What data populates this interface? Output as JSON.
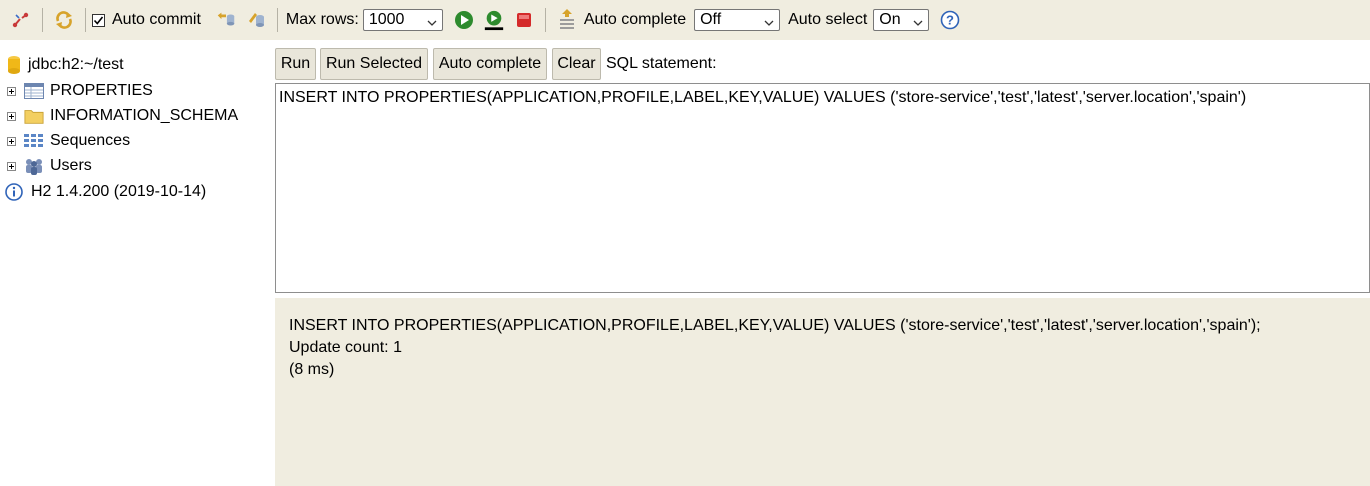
{
  "toolbar": {
    "auto_commit_label": "Auto commit",
    "auto_commit_checked": true,
    "max_rows_label": "Max rows:",
    "max_rows_value": "1000",
    "auto_complete_label": "Auto complete",
    "auto_complete_value": "Off",
    "auto_select_label": "Auto select",
    "auto_select_value": "On",
    "icons": [
      "disconnect-icon",
      "refresh-icon",
      "rollback-icon",
      "commit-icon",
      "run-icon",
      "run-selected-icon",
      "stop-icon",
      "history-icon",
      "help-icon"
    ]
  },
  "tree": {
    "connection": "jdbc:h2:~/test",
    "items": [
      {
        "label": "PROPERTIES",
        "icon": "table-icon"
      },
      {
        "label": "INFORMATION_SCHEMA",
        "icon": "folder-icon"
      },
      {
        "label": "Sequences",
        "icon": "sequences-icon"
      },
      {
        "label": "Users",
        "icon": "users-icon"
      }
    ],
    "version": "H2 1.4.200 (2019-10-14)"
  },
  "query": {
    "buttons": {
      "run": "Run",
      "run_selected": "Run Selected",
      "auto_complete": "Auto complete",
      "clear": "Clear"
    },
    "sql_label": "SQL statement:",
    "sql_text": "INSERT INTO PROPERTIES(APPLICATION,PROFILE,LABEL,KEY,VALUE) VALUES ('store-service','test','latest','server.location','spain')"
  },
  "result": {
    "statement": "INSERT INTO PROPERTIES(APPLICATION,PROFILE,LABEL,KEY,VALUE) VALUES ('store-service','test','latest','server.location','spain');",
    "update_count": "Update count: 1",
    "timing": "(8 ms)"
  },
  "colors": {
    "panel_bg": "#f0ede0",
    "button_bg": "#e9e6da",
    "run_green": "#2e8b2e",
    "stop_red": "#d42a2a"
  }
}
